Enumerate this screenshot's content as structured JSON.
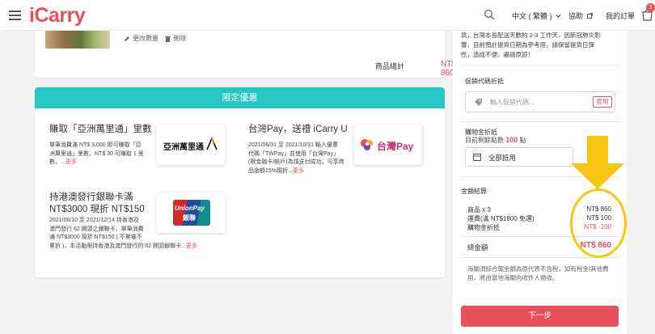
{
  "header": {
    "logo": "iCarry",
    "language": "中文 ( 繁體 )",
    "help": "協助",
    "orders": "我的訂單",
    "cart_count": "3",
    "icons": [
      "menu-icon",
      "search-icon",
      "chevron-down-icon",
      "external-link-icon",
      "cart-icon"
    ]
  },
  "product": {
    "edit_label": "更改數量",
    "delete_label": "刪除",
    "subtotal_label": "商品總計",
    "subtotal_value": "NT$ 860"
  },
  "promotions": {
    "header": "限定優惠",
    "items": [
      {
        "title": "賺取「亞洲萬里通」里數",
        "desc_lines": [
          "單筆消費滿 NT$ 3,000 即可賺取「亞",
          "洲萬里通」里數，NT$ 30 可賺取 1 里",
          "數，..."
        ],
        "more": "更多",
        "logo_text": "亞洲萬里通"
      },
      {
        "title": "台灣Pay，送禮 iCarry U",
        "desc_lines": [
          "2021/06/01 至 2021/10/31 輸入優惠",
          "代碼「TWPay」並使用「台灣Pay」",
          "(限金融卡/帳戶)為請支付成功，可享商",
          "品金額15%現折..."
        ],
        "more": "更多",
        "logo_text": "台灣Pay"
      },
      {
        "title_lines": [
          "持港澳發行銀聯卡滿",
          "NT$3000 現折 NT$150"
        ],
        "desc_lines": [
          "2021/06/10 至 2021/12/14 持香港及",
          "澳門發行 62 開頭之銀聯卡，單筆消費",
          "滿 NT$3000 現折 NT$150 ( 不累電不",
          "累折 )，本活動限持香港及澳門發行的 62 開頭銀聯卡..."
        ],
        "more": "更多",
        "logo_text_top": "UnionPay",
        "logo_text_bottom": "銀聯"
      }
    ]
  },
  "summary": {
    "top_notice_lines": [
      "貨，台灣本島配送天數約 2-3 工作天，因新冠肺炎影",
      "響，目前預計提貨日期為參考用，請保留提貨日彈",
      "性，造成不便，盡請原諒！"
    ],
    "promo_section_label": "促銷代碼折抵",
    "promo_placeholder": "輸入促銷代碼...",
    "apply_label": "套用",
    "credit_label": "購物金折抵",
    "credit_available_prefix": "目前剩餘點數",
    "credit_points": "100",
    "credit_unit": "點",
    "full_use_label": "全部抵用",
    "total_section_label": "金額結算",
    "rows": [
      {
        "label": "商品 x 3",
        "value": "NT$ 860"
      },
      {
        "label": "運費(滿 NT$1800 免運)",
        "value": "NT$ 100"
      },
      {
        "label": "購物金折抵",
        "value": "NT$ -100"
      }
    ],
    "total_label": "總金額",
    "total_value": "NT$ 860",
    "tax_note_lines": [
      "海關須綜合報金額為原代表不含稅，如有稅金/其他費",
      "用，將由當地海關向收件人徵收。"
    ],
    "next_button": "下一步"
  },
  "colors": {
    "brand": "#e8505b",
    "promo_header": "#25c6c3",
    "annotation": "#f7c614"
  }
}
